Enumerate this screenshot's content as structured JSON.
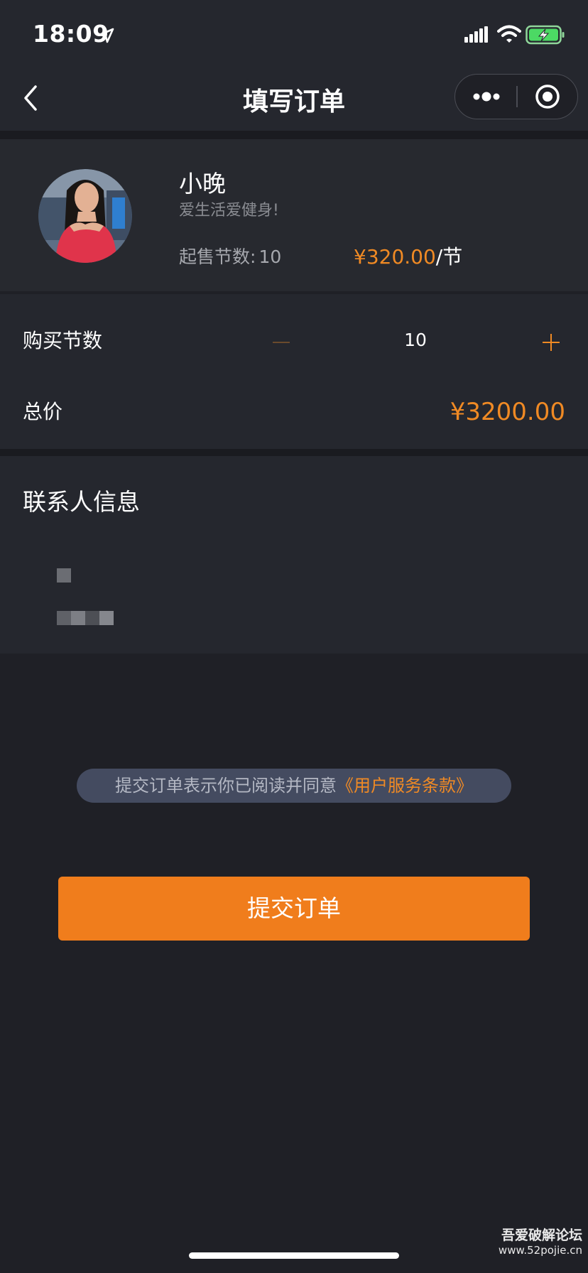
{
  "status_bar": {
    "time": "18:09"
  },
  "nav": {
    "title": "填写订单"
  },
  "product": {
    "name": "小晚",
    "motto": "爱生活爱健身!",
    "min_lessons_label": "起售节数:",
    "min_lessons_value": "10",
    "price": "¥320.00",
    "price_unit": "/节"
  },
  "quantity": {
    "label": "购买节数",
    "value": "10",
    "total_label": "总价",
    "total_value": "¥3200.00"
  },
  "contact": {
    "title": "联系人信息"
  },
  "agreement": {
    "text": "提交订单表示你已阅读并同意",
    "link": "《用户服务条款》"
  },
  "submit_label": "提交订单",
  "watermark": {
    "title": "吾爱破解论坛",
    "url": "www.52pojie.cn"
  },
  "colors": {
    "accent": "#f08a24",
    "button": "#f07d1c",
    "background": "#1f2026",
    "card": "#25272e"
  },
  "icons": [
    "location-arrow-icon",
    "signal-icon",
    "wifi-icon",
    "battery-charging-icon",
    "back-icon",
    "more-icon",
    "close-target-icon"
  ]
}
